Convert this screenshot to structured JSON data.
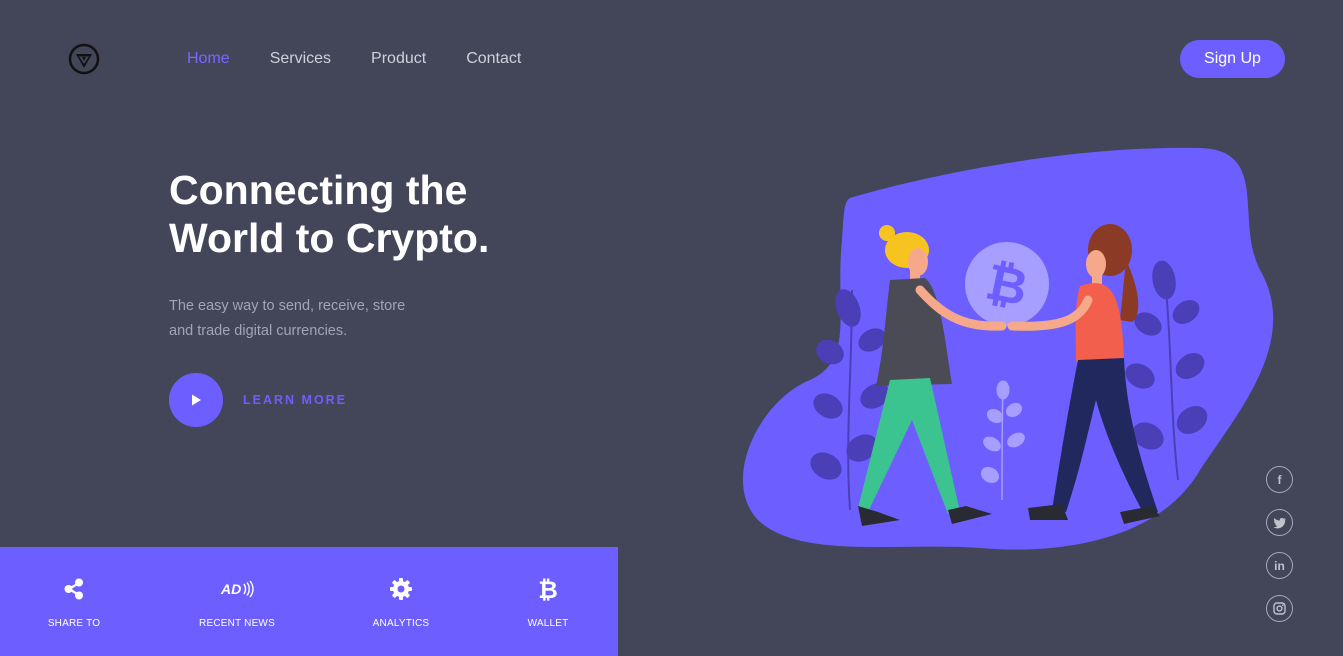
{
  "header": {
    "logo_icon": "crypto-shield-logo",
    "nav": [
      {
        "label": "Home",
        "active": true
      },
      {
        "label": "Services",
        "active": false
      },
      {
        "label": "Product",
        "active": false
      },
      {
        "label": "Contact",
        "active": false
      }
    ],
    "signup_label": "Sign Up"
  },
  "hero": {
    "title_line1": "Connecting the",
    "title_line2": "World to Crypto.",
    "subtitle_line1": "The easy way to send, receive, store",
    "subtitle_line2": "and trade digital currencies.",
    "play_icon": "play-icon",
    "learn_more_label": "LEARN MORE"
  },
  "illustration": {
    "description_icon": "two-people-exchanging-bitcoin"
  },
  "social": [
    {
      "icon": "facebook-icon"
    },
    {
      "icon": "twitter-icon"
    },
    {
      "icon": "linkedin-icon"
    },
    {
      "icon": "instagram-icon"
    }
  ],
  "features": [
    {
      "label": "SHARE TO",
      "icon": "share-icon"
    },
    {
      "label": "RECENT NEWS",
      "icon": "ad-audio-icon"
    },
    {
      "label": "ANALYTICS",
      "icon": "gear-icon"
    },
    {
      "label": "WALLET",
      "icon": "bitcoin-icon"
    }
  ],
  "colors": {
    "background": "#434559",
    "accent": "#6d5fff",
    "text_light": "#ffffff",
    "text_muted": "#a3a5b5"
  }
}
